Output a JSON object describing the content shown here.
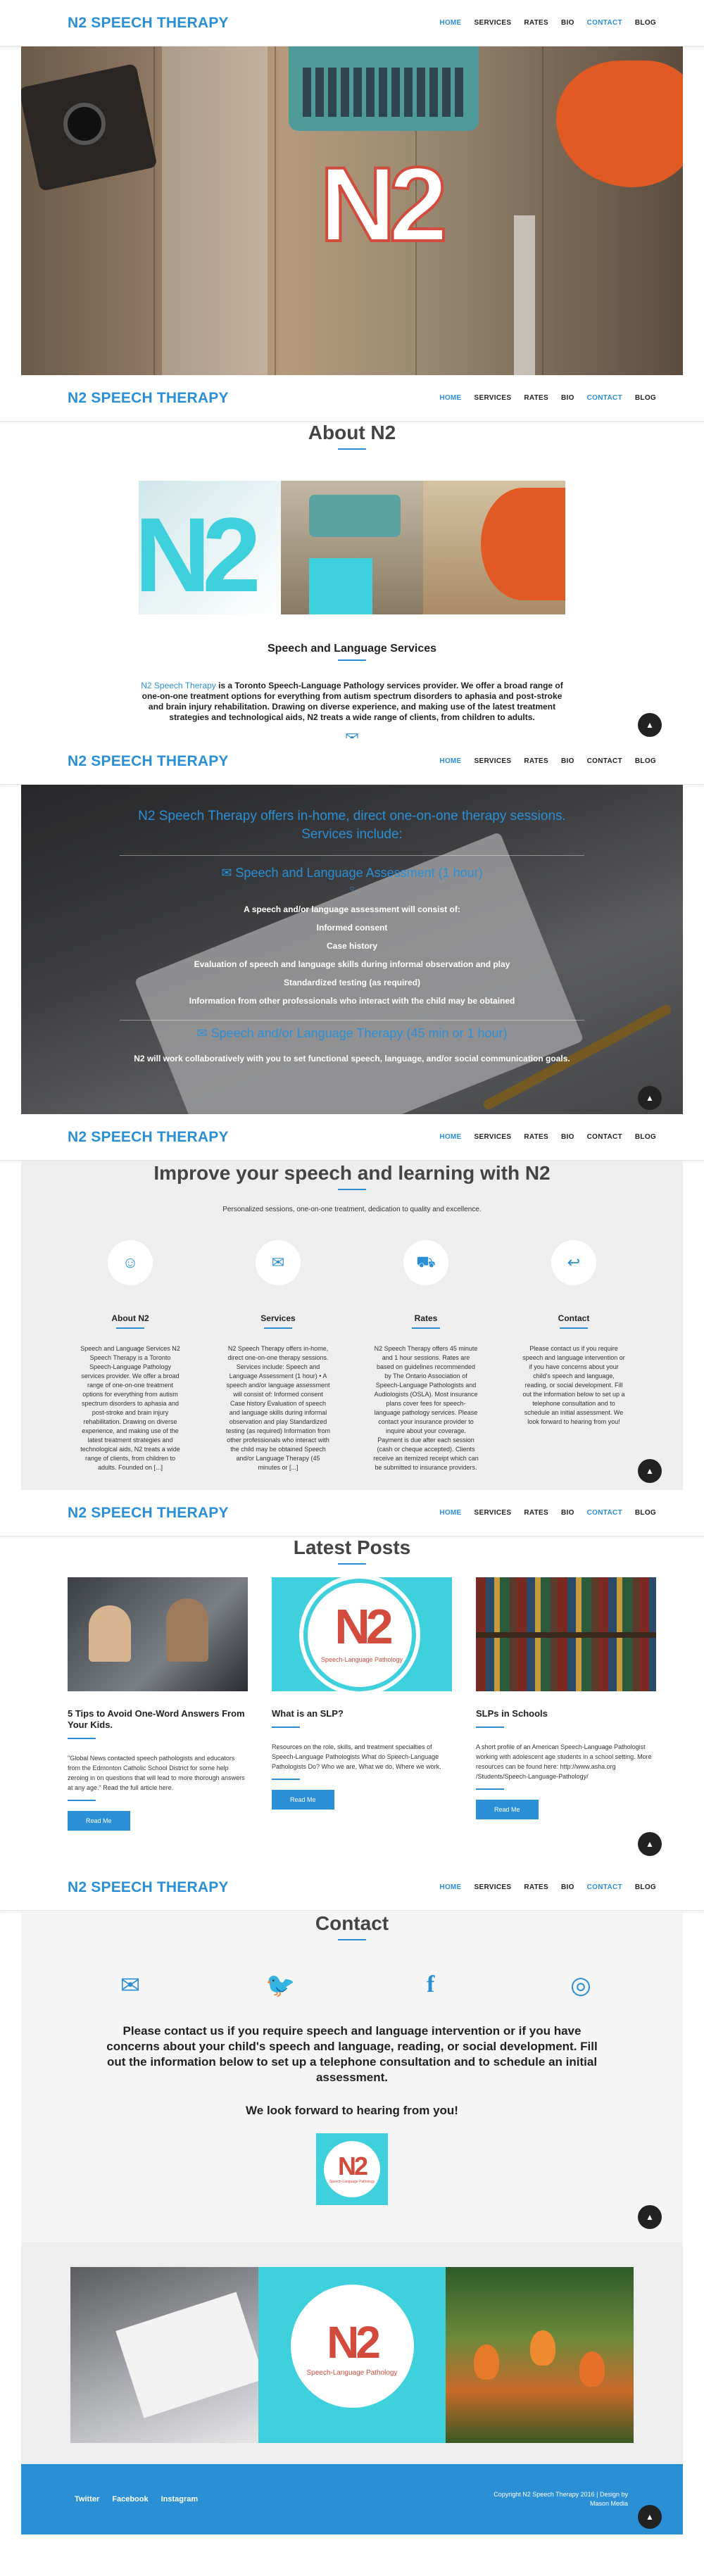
{
  "brand": "N2 SPEECH THERAPY",
  "nav": [
    "HOME",
    "SERVICES",
    "RATES",
    "BIO",
    "CONTACT",
    "BLOG"
  ],
  "hero_logo": "N2",
  "about": {
    "title": "About N2",
    "subtitle": "Speech and Language Services",
    "link_text": "N2 Speech Therapy",
    "body": " is a Toronto Speech-Language Pathology services provider. We offer a broad range of one-on-one treatment options for everything from autism spectrum disorders to aphasia and post-stroke and brain injury rehabilitation. Drawing on diverse experience, and making use of the latest treatment strategies and technological aids, N2 treats a wide range of clients, from children to adults."
  },
  "services_band": {
    "heading": "N2 Speech Therapy offers in-home, direct one-on-one therapy sessions. Services include:",
    "assessment": "Speech and Language Assessment (1 hour)",
    "items": [
      "A speech and/or language assessment will consist of:",
      "Informed consent",
      "Case history",
      "Evaluation of speech and language skills during informal observation and play",
      "Standardized testing (as required)",
      "Information from other professionals who interact with the child may be obtained"
    ],
    "therapy": "Speech and/or Language Therapy (45 min or 1 hour)",
    "footer": "N2 will work collaboratively with you to set functional speech, language, and/or social communication goals."
  },
  "improve": {
    "title": "Improve your speech and learning with N2",
    "tagline": "Personalized sessions, one-on-one treatment, dedication to quality and excellence.",
    "features": [
      {
        "icon": "child-icon",
        "glyph": "☺",
        "title": "About N2",
        "text": "Speech and Language Services N2 Speech Therapy is a Toronto Speech-Language Pathology services provider. We offer a broad range of one-on-one treatment options for everything from autism spectrum disorders to aphasia and post-stroke and brain injury rehabilitation. Drawing on diverse experience, and making use of the latest treatment strategies and technological aids, N2 treats a wide range of clients, from children to adults. Founded on [...]"
      },
      {
        "icon": "chat-icon",
        "glyph": "✉",
        "title": "Services",
        "text": "N2 Speech Therapy offers in-home, direct one-on-one therapy sessions. Services include: Speech and Language Assessment (1 hour) • A speech and/or language assessment will consist of: Informed consent Case history Evaluation of speech and language skills during informal observation and play Standardized testing (as required) Information from other professionals who interact with the child may be obtained Speech and/or Language Therapy (45 minutes or [...]"
      },
      {
        "icon": "cart-icon",
        "glyph": "⛟",
        "title": "Rates",
        "text": "N2 Speech Therapy offers 45 minute and 1 hour sessions. Rates are based on guidelines recommended by The Ontario Association of Speech-Language Pathologists and Audiologists (OSLA). Most insurance plans cover fees for speech-language pathology services. Please contact your insurance provider to inquire about your coverage. Payment is due after each session (cash or cheque accepted). Clients receive an itemized receipt which can be submitted to insurance providers."
      },
      {
        "icon": "reply-icon",
        "glyph": "↩",
        "title": "Contact",
        "text": "Please contact us if you require speech and language intervention or if you have concerns about your child's speech and language, reading, or social development. Fill out the information below to set up a telephone consultation and to schedule an initial assessment. We look forward to hearing from you!"
      }
    ]
  },
  "posts": {
    "title": "Latest Posts",
    "items": [
      {
        "title": "5 Tips to Avoid One-Word Answers From Your Kids.",
        "text": "\"Global News contacted speech pathologists and educators from the Edmonton Catholic School District for some help zeroing in on questions that will lead to more thorough answers at any age.\" Read the full article here.",
        "button": "Read Me"
      },
      {
        "title": "What is an SLP?",
        "text": "Resources on the role, skills, and treatment specialties of Speech-Language Pathologists What do Speech-Language Pathologists Do? Who we are, What we do, Where we work.",
        "button": "Read Me"
      },
      {
        "title": "SLPs in Schools",
        "text": "A short profile of an American Speech-Language Pathologist working with adolescent age students in a school setting. More resources can be found here: http://www.asha.org /Students/Speech-Language-Pathology/",
        "button": "Read Me"
      }
    ],
    "logo_text": "N2",
    "logo_sub": "Speech-Language Pathology"
  },
  "contact": {
    "title": "Contact",
    "message": "Please contact us if you require speech and language intervention or if you have concerns about your child's speech and language, reading, or social development. Fill out the information below to set up a telephone consultation and to schedule an initial assessment.",
    "closing": "We look forward to hearing from you!",
    "logo_text": "N2",
    "logo_sub": "Speech-Language Pathology"
  },
  "gallery": {
    "logo_text": "N2",
    "logo_sub": "Speech-Language Pathology"
  },
  "footer": {
    "links": [
      "Twitter",
      "Facebook",
      "Instagram"
    ],
    "copyright": "Copyright N2 Speech Therapy 2016 | Design by",
    "designer": "Mason Media"
  },
  "colors": {
    "accent": "#2b8fd6",
    "teal": "#3fd0de",
    "dark": "#222222",
    "gray_bg": "#eeeeee"
  }
}
